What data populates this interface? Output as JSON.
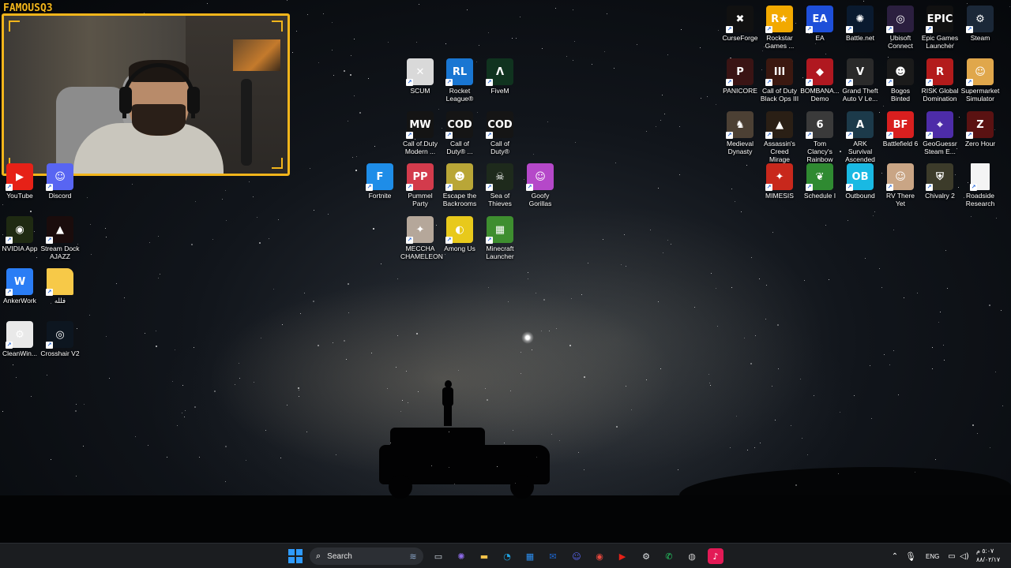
{
  "webcam": {
    "overlay_text": "FAMOUSQ3"
  },
  "desktop_left": [
    {
      "label": "YouTube",
      "icon": "youtube-icon",
      "color": "#e62117",
      "glyph": "▶"
    },
    {
      "label": "Discord",
      "icon": "discord-icon",
      "color": "#5865f2",
      "glyph": "☺"
    },
    {
      "label": "NVIDIA App",
      "icon": "nvidia-icon",
      "color": "#1f2a12",
      "glyph": "◉"
    },
    {
      "label": "Stream Dock AJAZZ",
      "icon": "stream-dock-icon",
      "color": "#1a0c0c",
      "glyph": "▲"
    },
    {
      "label": "AnkerWork",
      "icon": "ankerwork-icon",
      "color": "#2a7df5",
      "glyph": "W"
    },
    {
      "label": "فلله",
      "icon": "folder-icon",
      "color": "#f7c948",
      "glyph": ""
    },
    {
      "label": "CleanWin...",
      "icon": "cleanwin-icon",
      "color": "#e9e9e9",
      "glyph": "⚙"
    },
    {
      "label": "Crosshair V2",
      "icon": "crosshair-icon",
      "color": "#0d1620",
      "glyph": "◎"
    }
  ],
  "desktop_center": [
    {
      "label": "SCUM",
      "icon": "scum-icon",
      "color": "#d9d9d9",
      "glyph": "✕"
    },
    {
      "label": "Rocket League®",
      "icon": "rocket-league-icon",
      "color": "#1976d2",
      "glyph": "RL"
    },
    {
      "label": "FiveM",
      "icon": "fivem-icon",
      "color": "#10331f",
      "glyph": "Λ"
    },
    {
      "label": "Call of Duty Modern ...",
      "icon": "cod-modern-icon",
      "color": "#141414",
      "glyph": "MW"
    },
    {
      "label": "Call of Duty® ...",
      "icon": "cod-duty-icon",
      "color": "#151515",
      "glyph": "COD"
    },
    {
      "label": "Call of Duty®",
      "icon": "cod-icon",
      "color": "#151515",
      "glyph": "COD"
    },
    {
      "label": "Fortnite",
      "icon": "fortnite-icon",
      "color": "#1e8de8",
      "glyph": "F"
    },
    {
      "label": "Pummel Party",
      "icon": "pummel-party-icon",
      "color": "#d33b4c",
      "glyph": "PP"
    },
    {
      "label": "Escape the Backrooms",
      "icon": "escape-backrooms-icon",
      "color": "#b9a637",
      "glyph": "☻"
    },
    {
      "label": "Sea of Thieves",
      "icon": "sea-of-thieves-icon",
      "color": "#1e2a1c",
      "glyph": "☠"
    },
    {
      "label": "Goofy Gorillas",
      "icon": "goofy-gorillas-icon",
      "color": "#b548c9",
      "glyph": "☺"
    },
    {
      "label": "MECCHA CHAMELEON",
      "icon": "meccha-chameleon-icon",
      "color": "#b5a79a",
      "glyph": "✦"
    },
    {
      "label": "Among Us",
      "icon": "among-us-icon",
      "color": "#e8c91b",
      "glyph": "◐"
    },
    {
      "label": "Minecraft Launcher",
      "icon": "minecraft-icon",
      "color": "#3e8e2f",
      "glyph": "▦"
    }
  ],
  "desktop_right": [
    {
      "label": "CurseForge",
      "icon": "curseforge-icon",
      "color": "#111",
      "glyph": "✖"
    },
    {
      "label": "Rockstar Games ...",
      "icon": "rockstar-icon",
      "color": "#f2a900",
      "glyph": "R★"
    },
    {
      "label": "EA",
      "icon": "ea-icon",
      "color": "#1e4fd9",
      "glyph": "EA"
    },
    {
      "label": "Battle.net",
      "icon": "battlenet-icon",
      "color": "#0a1a2f",
      "glyph": "✺"
    },
    {
      "label": "Ubisoft Connect",
      "icon": "ubisoft-icon",
      "color": "#2b1f3f",
      "glyph": "◎"
    },
    {
      "label": "Epic Games Launcher",
      "icon": "epic-icon",
      "color": "#111",
      "glyph": "EPIC"
    },
    {
      "label": "Steam",
      "icon": "steam-icon",
      "color": "#1b2838",
      "glyph": "⚙"
    },
    {
      "label": "PANICORE",
      "icon": "panicore-icon",
      "color": "#3a1414",
      "glyph": "P"
    },
    {
      "label": "Call of Duty Black Ops III",
      "icon": "cod-bo3-icon",
      "color": "#3b1810",
      "glyph": "III"
    },
    {
      "label": "BOMBANA... Demo",
      "icon": "bombana-icon",
      "color": "#b01820",
      "glyph": "◆"
    },
    {
      "label": "Grand Theft Auto V Le...",
      "icon": "gta-icon",
      "color": "#2a2a2a",
      "glyph": "V"
    },
    {
      "label": "Bogos Binted",
      "icon": "bogos-binted-icon",
      "color": "#1a1a1a",
      "glyph": "☻"
    },
    {
      "label": "RISK Global Domination",
      "icon": "risk-icon",
      "color": "#b31b1b",
      "glyph": "R"
    },
    {
      "label": "Supermarket Simulator",
      "icon": "supermarket-icon",
      "color": "#e0a74b",
      "glyph": "☺"
    },
    {
      "label": "Medieval Dynasty",
      "icon": "medieval-dynasty-icon",
      "color": "#4c4034",
      "glyph": "♞"
    },
    {
      "label": "Assassin's Creed Mirage",
      "icon": "ac-mirage-icon",
      "color": "#2a1f15",
      "glyph": "▲"
    },
    {
      "label": "Tom Clancy's Rainbow Si...",
      "icon": "rainbow-six-icon",
      "color": "#3a3a3a",
      "glyph": "6"
    },
    {
      "label": "ARK Survival Ascended",
      "icon": "ark-icon",
      "color": "#1c3a4a",
      "glyph": "A"
    },
    {
      "label": "Battlefield 6",
      "icon": "battlefield-icon",
      "color": "#d81f1f",
      "glyph": "BF"
    },
    {
      "label": "GeoGuessr Steam E...",
      "icon": "geoguessr-icon",
      "color": "#4d2ca8",
      "glyph": "⌖"
    },
    {
      "label": "Zero Hour",
      "icon": "zero-hour-icon",
      "color": "#5a1212",
      "glyph": "Z"
    },
    {
      "label": "MIMESIS",
      "icon": "mimesis-icon",
      "color": "#c8281c",
      "glyph": "✦"
    },
    {
      "label": "Schedule I",
      "icon": "schedule-i-icon",
      "color": "#2f8a31",
      "glyph": "❦"
    },
    {
      "label": "Outbound",
      "icon": "outbound-icon",
      "color": "#19b9e3",
      "glyph": "OB"
    },
    {
      "label": "RV There Yet",
      "icon": "rv-there-yet-icon",
      "color": "#c9a585",
      "glyph": "☺"
    },
    {
      "label": "Chivalry 2",
      "icon": "chivalry-icon",
      "color": "#3c3b2a",
      "glyph": "⛨"
    },
    {
      "label": "Roadside Research",
      "icon": "roadside-research-icon",
      "color": "#f4f4f4",
      "glyph": ""
    }
  ],
  "taskbar": {
    "search_label": "Search",
    "apps": [
      {
        "name": "shark-widget-icon",
        "glyph": "≋",
        "color": "#8aa6c9"
      },
      {
        "name": "task-view-icon",
        "glyph": "▭",
        "color": "#cfd6df"
      },
      {
        "name": "copilot-icon",
        "glyph": "✺",
        "color": "#8d6be8"
      },
      {
        "name": "file-explorer-icon",
        "glyph": "▬",
        "color": "#f3c24a"
      },
      {
        "name": "edge-icon",
        "glyph": "◔",
        "color": "#1fa3e3"
      },
      {
        "name": "microsoft-store-icon",
        "glyph": "▦",
        "color": "#2c8ef0"
      },
      {
        "name": "outlook-icon",
        "glyph": "✉",
        "color": "#1d66cf"
      },
      {
        "name": "discord-taskbar-icon",
        "glyph": "☺",
        "color": "#5865f2"
      },
      {
        "name": "chrome-icon",
        "glyph": "◉",
        "color": "#e6483e"
      },
      {
        "name": "youtube-taskbar-icon",
        "glyph": "▶",
        "color": "#e62117"
      },
      {
        "name": "steam-taskbar-icon",
        "glyph": "⚙",
        "color": "#dfe3e6"
      },
      {
        "name": "whatsapp-icon",
        "glyph": "✆",
        "color": "#25d366"
      },
      {
        "name": "obs-icon",
        "glyph": "◍",
        "color": "#c9c9c9"
      },
      {
        "name": "tiktok-icon",
        "glyph": "♪",
        "color": "#e31a56"
      }
    ],
    "tray": {
      "language": "ENG",
      "time": "٥:٠٧ م",
      "date": "٨٨/٠٢/١٧"
    }
  }
}
